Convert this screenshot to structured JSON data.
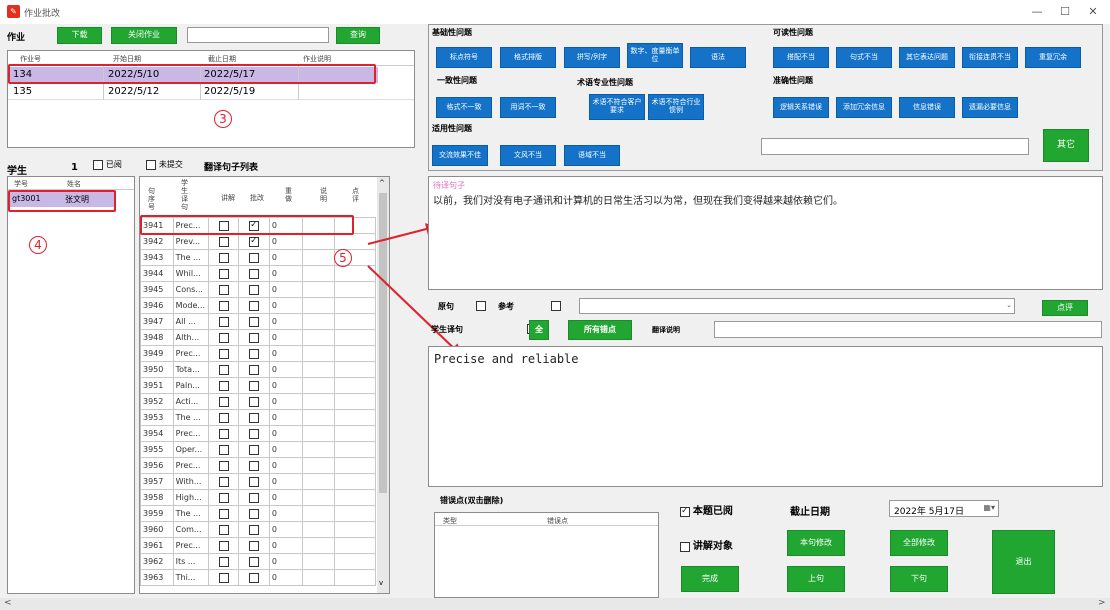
{
  "window": {
    "title": "作业批改",
    "minimize": "—",
    "maximize": "☐",
    "close": "✕"
  },
  "top": {
    "label": "作业",
    "download": "下载",
    "close_homework": "关闭作业",
    "query": "查询",
    "search_value": ""
  },
  "hw_table": {
    "headers": [
      "作业号",
      "开始日期",
      "截止日期",
      "作业说明"
    ],
    "rows": [
      [
        "134",
        "2022/5/10",
        "2022/5/17",
        ""
      ],
      [
        "135",
        "2022/5/12",
        "2022/5/19",
        ""
      ]
    ]
  },
  "students": {
    "label": "学生",
    "count": "1",
    "read_label": "已阅",
    "unsubmitted_label": "未提交",
    "sentence_list_label": "翻译句子列表",
    "headers": [
      "学号",
      "姓名"
    ],
    "rows": [
      [
        "gt3001",
        "张文明"
      ]
    ]
  },
  "sentences": {
    "headers": [
      "句序号",
      "学生译句",
      "讲解",
      "批改",
      "重做",
      "说明",
      "点评"
    ],
    "rows": [
      {
        "id": "3941",
        "text": "Prec...",
        "explain": false,
        "revise": true,
        "redo": "0"
      },
      {
        "id": "3942",
        "text": "Prev...",
        "explain": false,
        "revise": true,
        "redo": "0"
      },
      {
        "id": "3943",
        "text": "The ...",
        "explain": false,
        "revise": false,
        "redo": "0"
      },
      {
        "id": "3944",
        "text": "Whil...",
        "explain": false,
        "revise": false,
        "redo": "0"
      },
      {
        "id": "3945",
        "text": "Cons...",
        "explain": false,
        "revise": false,
        "redo": "0"
      },
      {
        "id": "3946",
        "text": "Mode...",
        "explain": false,
        "revise": false,
        "redo": "0"
      },
      {
        "id": "3947",
        "text": "All ...",
        "explain": false,
        "revise": false,
        "redo": "0"
      },
      {
        "id": "3948",
        "text": "Alth...",
        "explain": false,
        "revise": false,
        "redo": "0"
      },
      {
        "id": "3949",
        "text": "Prec...",
        "explain": false,
        "revise": false,
        "redo": "0"
      },
      {
        "id": "3950",
        "text": "Tota...",
        "explain": false,
        "revise": false,
        "redo": "0"
      },
      {
        "id": "3951",
        "text": "Paln...",
        "explain": false,
        "revise": false,
        "redo": "0"
      },
      {
        "id": "3952",
        "text": "Acti...",
        "explain": false,
        "revise": false,
        "redo": "0"
      },
      {
        "id": "3953",
        "text": "The ...",
        "explain": false,
        "revise": false,
        "redo": "0"
      },
      {
        "id": "3954",
        "text": "Prec...",
        "explain": false,
        "revise": false,
        "redo": "0"
      },
      {
        "id": "3955",
        "text": "Oper...",
        "explain": false,
        "revise": false,
        "redo": "0"
      },
      {
        "id": "3956",
        "text": "Prec...",
        "explain": false,
        "revise": false,
        "redo": "0"
      },
      {
        "id": "3957",
        "text": "With...",
        "explain": false,
        "revise": false,
        "redo": "0"
      },
      {
        "id": "3958",
        "text": "High...",
        "explain": false,
        "revise": false,
        "redo": "0"
      },
      {
        "id": "3959",
        "text": "The ...",
        "explain": false,
        "revise": false,
        "redo": "0"
      },
      {
        "id": "3960",
        "text": "Com...",
        "explain": false,
        "revise": false,
        "redo": "0"
      },
      {
        "id": "3961",
        "text": "Prec...",
        "explain": false,
        "revise": false,
        "redo": "0"
      },
      {
        "id": "3962",
        "text": "Its ...",
        "explain": false,
        "revise": false,
        "redo": "0"
      },
      {
        "id": "3963",
        "text": "Thi...",
        "explain": false,
        "revise": false,
        "redo": "0"
      }
    ]
  },
  "errors": {
    "basic_label": "基础性问题",
    "basic": [
      "标点符号",
      "格式排版",
      "拼写/列字",
      "数字、度量衡单位",
      "语法"
    ],
    "consistency_label": "一致性问题",
    "consistency": [
      "格式不一致",
      "用词不一致"
    ],
    "term_label": "术语专业性问题",
    "term": [
      "术语不符合客户要求",
      "术语不符合行业惯例"
    ],
    "readability_label": "可读性问题",
    "readability": [
      "搭配不当",
      "句式不当",
      "其它表达问题",
      "衔接连贯不当",
      "重复冗余"
    ],
    "accuracy_label": "准确性问题",
    "accuracy": [
      "逻辑关系错误",
      "添加冗余信息",
      "信息错误",
      "遗漏必要信息"
    ],
    "usability_label": "适用性问题",
    "usability": [
      "交流效果不佳",
      "文风不当",
      "语域不当"
    ],
    "other": "其它"
  },
  "source": {
    "label": "待译句子",
    "text": "以前，我们对没有电子通讯和计算机的日常生活习以为常，但现在我们变得越来越依赖它们。"
  },
  "controls": {
    "original": "原句",
    "reference": "参考",
    "student_translation": "学生译句",
    "all": "全",
    "all_errors": "所有错点",
    "translation_note": "翻译说明",
    "comment": "点评"
  },
  "translation": {
    "text": "Precise and reliable"
  },
  "error_points": {
    "label": "错误点(双击删除)",
    "headers": [
      "类型",
      "错误点"
    ]
  },
  "bottom": {
    "reviewed": "本题已阅",
    "deadline_label": "截止日期",
    "deadline_value": "2022年 5月17日",
    "explain_target": "讲解对象",
    "revise_sentence": "本句修改",
    "revise_all": "全部修改",
    "done": "完成",
    "prev": "上句",
    "next": "下句",
    "exit": "退出"
  },
  "annotations": {
    "a3": "3",
    "a4": "4",
    "a5": "5"
  }
}
